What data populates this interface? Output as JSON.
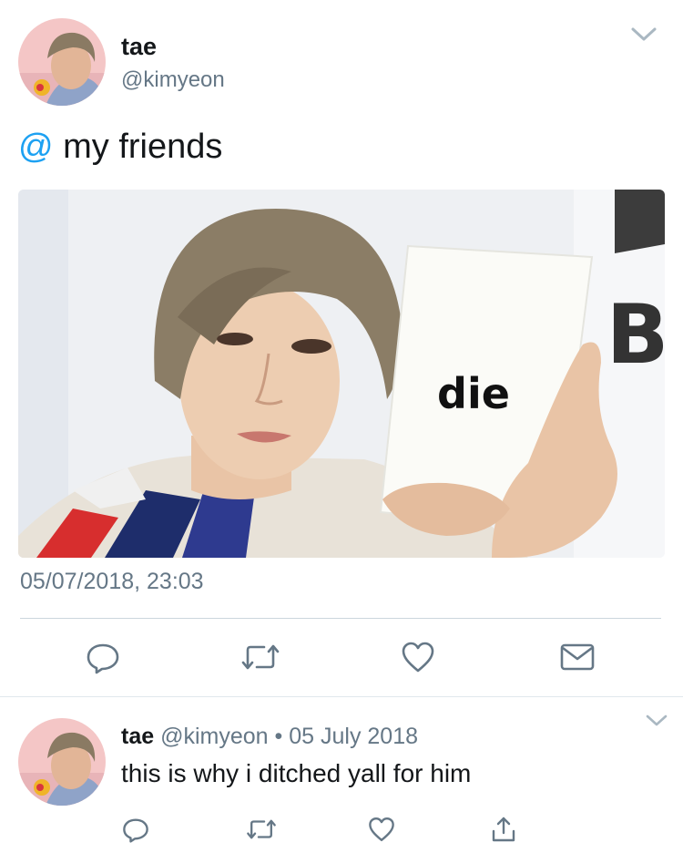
{
  "main_tweet": {
    "author_name": "tae",
    "author_handle": "@kimyeon",
    "text_mention": "@",
    "text_rest": " my friends",
    "media_caption": "die",
    "media_logo": "B",
    "timestamp": "05/07/2018, 23:03",
    "actions": [
      "reply-icon",
      "retweet-icon",
      "like-icon",
      "message-icon"
    ]
  },
  "reply_tweet": {
    "author_name": "tae",
    "author_handle": "@kimyeon",
    "separator": "•",
    "date": "05 July 2018",
    "text": "this is why i ditched yall for him",
    "actions": [
      "reply-icon",
      "retweet-icon",
      "like-icon",
      "share-icon"
    ]
  },
  "colors": {
    "accent": "#1da1f2",
    "muted_text": "#657786",
    "icon": "#657786",
    "divider": "#ccd6dd"
  }
}
